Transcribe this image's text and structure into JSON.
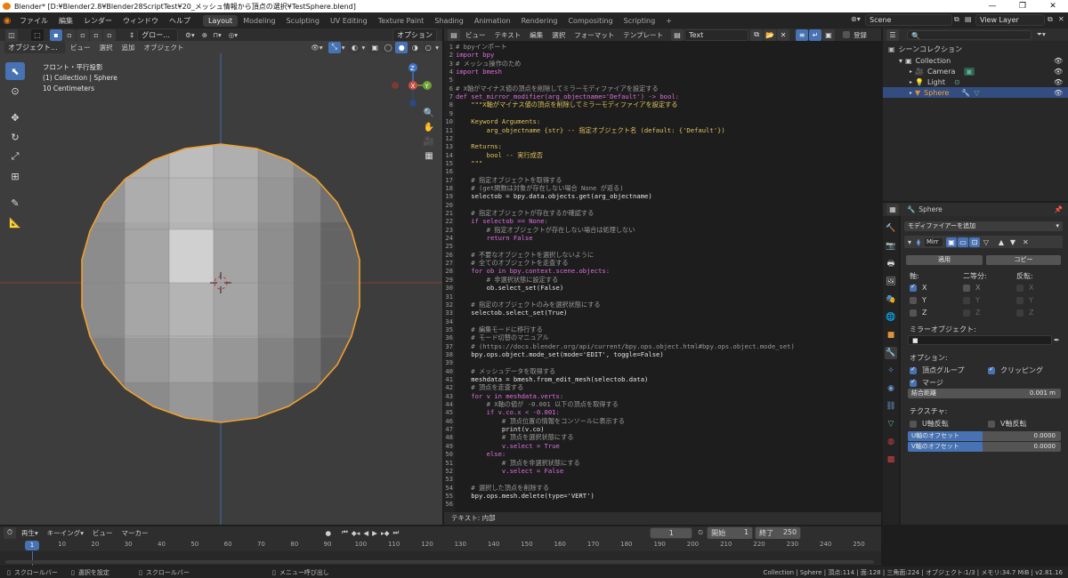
{
  "window": {
    "title": "Blender* [D:¥Blender2.8¥Blender28ScriptTest¥20_メッシュ情報から頂点の選択¥TestSphere.blend]",
    "controls": [
      "—",
      "❐",
      "✕"
    ]
  },
  "menubar": {
    "items": [
      "ファイル",
      "編集",
      "レンダー",
      "ウィンドウ",
      "ヘルプ"
    ],
    "workspaces": [
      "Layout",
      "Modeling",
      "Sculpting",
      "UV Editing",
      "Texture Paint",
      "Shading",
      "Animation",
      "Rendering",
      "Compositing",
      "Scripting"
    ],
    "active_workspace": "Layout",
    "add_tab": "+",
    "scene": "Scene",
    "view_layer": "View Layer"
  },
  "viewport": {
    "header": {
      "mode": "オブジェクト...",
      "menus": [
        "ビュー",
        "選択",
        "追加",
        "オブジェクト"
      ],
      "transform": "グロー...",
      "options": "オプション"
    },
    "info": [
      "フロント・平行投影",
      "(1) Collection | Sphere",
      "10 Centimeters"
    ],
    "gizmo": {
      "z": "Z",
      "y": "Y",
      "x": "X"
    }
  },
  "text_editor": {
    "menus": [
      "ビュー",
      "テキスト",
      "編集",
      "選択",
      "フォーマット",
      "テンプレート"
    ],
    "text_name": "Text",
    "register": "登録",
    "footer": "テキスト: 内部",
    "lines": [
      {
        "n": "1",
        "t": "# bpyインポート",
        "c": "cm"
      },
      {
        "n": "2",
        "t": "import bpy",
        "c": "kw"
      },
      {
        "n": "3",
        "t": "# メッシュ操作のため",
        "c": "cm"
      },
      {
        "n": "4",
        "t": "import bmesh",
        "c": "kw"
      },
      {
        "n": "5",
        "t": "",
        "c": "df"
      },
      {
        "n": "6",
        "t": "# X軸がマイナス値の頂点を削除してミラーモディファイアを設定する",
        "c": "cm"
      },
      {
        "n": "7",
        "t": "def set_mirror_modifier(arg_objectname='Default') -> bool:",
        "c": "kw"
      },
      {
        "n": "8",
        "t": "    \"\"\"X軸がマイナス値の頂点を削除してミラーモディファイアを設定する",
        "c": "st"
      },
      {
        "n": "9",
        "t": "",
        "c": "st"
      },
      {
        "n": "10",
        "t": "    Keyword Arguments:",
        "c": "st"
      },
      {
        "n": "11",
        "t": "        arg_objectname {str} -- 指定オブジェクト名 (default: {'Default'})",
        "c": "st"
      },
      {
        "n": "12",
        "t": "",
        "c": "st"
      },
      {
        "n": "13",
        "t": "    Returns:",
        "c": "st"
      },
      {
        "n": "14",
        "t": "        bool -- 実行成否",
        "c": "st"
      },
      {
        "n": "15",
        "t": "    \"\"\"",
        "c": "st"
      },
      {
        "n": "16",
        "t": "",
        "c": "df"
      },
      {
        "n": "17",
        "t": "    # 指定オブジェクトを取得する",
        "c": "cm"
      },
      {
        "n": "18",
        "t": "    # (get関数は対象が存在しない場合 None が返る)",
        "c": "cm"
      },
      {
        "n": "19",
        "t": "    selectob = bpy.data.objects.get(arg_objectname)",
        "c": "df"
      },
      {
        "n": "20",
        "t": "",
        "c": "df"
      },
      {
        "n": "21",
        "t": "    # 指定オブジェクトが存在するか確認する",
        "c": "cm"
      },
      {
        "n": "22",
        "t": "    if selectob == None:",
        "c": "kw"
      },
      {
        "n": "23",
        "t": "        # 指定オブジェクトが存在しない場合は処理しない",
        "c": "cm"
      },
      {
        "n": "24",
        "t": "        return False",
        "c": "kw"
      },
      {
        "n": "25",
        "t": "",
        "c": "df"
      },
      {
        "n": "26",
        "t": "    # 不要なオブジェクトを選択しないように",
        "c": "cm"
      },
      {
        "n": "27",
        "t": "    # 全てのオブジェクトを走査する",
        "c": "cm"
      },
      {
        "n": "28",
        "t": "    for ob in bpy.context.scene.objects:",
        "c": "kw"
      },
      {
        "n": "29",
        "t": "        # 非選択状態に設定する",
        "c": "cm"
      },
      {
        "n": "30",
        "t": "        ob.select_set(False)",
        "c": "df"
      },
      {
        "n": "31",
        "t": "",
        "c": "df"
      },
      {
        "n": "32",
        "t": "    # 指定のオブジェクトのみを選択状態にする",
        "c": "cm"
      },
      {
        "n": "33",
        "t": "    selectob.select_set(True)",
        "c": "df"
      },
      {
        "n": "34",
        "t": "",
        "c": "df"
      },
      {
        "n": "35",
        "t": "    # 編集モードに移行する",
        "c": "cm"
      },
      {
        "n": "36",
        "t": "    # モード切替のマニュアル",
        "c": "cm"
      },
      {
        "n": "37",
        "t": "    # (https://docs.blender.org/api/current/bpy.ops.object.html#bpy.ops.object.mode_set)",
        "c": "cm"
      },
      {
        "n": "38",
        "t": "    bpy.ops.object.mode_set(mode='EDIT', toggle=False)",
        "c": "df"
      },
      {
        "n": "39",
        "t": "",
        "c": "df"
      },
      {
        "n": "40",
        "t": "    # メッシュデータを取得する",
        "c": "cm"
      },
      {
        "n": "41",
        "t": "    meshdata = bmesh.from_edit_mesh(selectob.data)",
        "c": "df"
      },
      {
        "n": "42",
        "t": "    # 頂点を走査する",
        "c": "cm"
      },
      {
        "n": "43",
        "t": "    for v in meshdata.verts:",
        "c": "kw"
      },
      {
        "n": "44",
        "t": "        # X軸の値が -0.001 以下の頂点を取得する",
        "c": "cm"
      },
      {
        "n": "45",
        "t": "        if v.co.x < -0.001:",
        "c": "kw"
      },
      {
        "n": "46",
        "t": "            # 頂点位置の情報をコンソールに表示する",
        "c": "cm"
      },
      {
        "n": "47",
        "t": "            print(v.co)",
        "c": "df"
      },
      {
        "n": "48",
        "t": "            # 頂点を選択状態にする",
        "c": "cm"
      },
      {
        "n": "49",
        "t": "            v.select = True",
        "c": "kw"
      },
      {
        "n": "50",
        "t": "        else:",
        "c": "kw"
      },
      {
        "n": "51",
        "t": "            # 頂点を非選択状態にする",
        "c": "cm"
      },
      {
        "n": "52",
        "t": "            v.select = False",
        "c": "kw"
      },
      {
        "n": "53",
        "t": "",
        "c": "df"
      },
      {
        "n": "54",
        "t": "    # 選択した頂点を削除する",
        "c": "cm"
      },
      {
        "n": "55",
        "t": "    bpy.ops.mesh.delete(type='VERT')",
        "c": "df"
      },
      {
        "n": "56",
        "t": "",
        "c": "df"
      }
    ]
  },
  "outliner": {
    "root": "シーンコレクション",
    "items": [
      {
        "label": "Collection",
        "icon": "collection-icon"
      },
      {
        "label": "Camera",
        "icon": "camera-icon"
      },
      {
        "label": "Light",
        "icon": "light-icon"
      },
      {
        "label": "Sphere",
        "icon": "mesh-icon"
      }
    ]
  },
  "properties": {
    "object_name": "Sphere",
    "add_modifier": "モディファイアーを追加",
    "modifier_name": "Mirr",
    "apply": "適用",
    "copy": "コピー",
    "axis_label": "軸:",
    "bisect_label": "二等分:",
    "flip_label": "反転:",
    "axes": [
      "X",
      "Y",
      "Z"
    ],
    "axis_checked": [
      true,
      false,
      false
    ],
    "mirror_object_label": "ミラーオブジェクト:",
    "options_label": "オプション:",
    "vertex_groups": "頂点グループ",
    "clipping": "クリッピング",
    "merge": "マージ",
    "merge_distance_label": "結合距離",
    "merge_distance_value": "0.001 m",
    "textures_label": "テクスチャ:",
    "u_flip": "U軸反転",
    "v_flip": "V軸反転",
    "u_offset_label": "U軸のオフセット",
    "u_offset_value": "0.0000",
    "v_offset_label": "V軸のオフセット",
    "v_offset_value": "0.0000"
  },
  "timeline": {
    "menus": [
      "再生",
      "キーイング",
      "ビュー",
      "マーカー"
    ],
    "current_frame": "1",
    "start_label": "開始",
    "start_value": "1",
    "end_label": "終了",
    "end_value": "250",
    "ticks": [
      "1",
      "10",
      "20",
      "30",
      "40",
      "50",
      "60",
      "70",
      "80",
      "90",
      "100",
      "110",
      "120",
      "130",
      "140",
      "150",
      "160",
      "170",
      "180",
      "190",
      "200",
      "210",
      "220",
      "230",
      "240",
      "250"
    ]
  },
  "statusbar": {
    "left": [
      "スクロールバー",
      "選択を設定",
      "スクロールバー",
      "メニュー呼び出し"
    ],
    "right": "Collection | Sphere | 頂点:114 | 面:128 | 三角面:224 | オブジェクト:1/3 | メモリ:34.7 MiB | v2.81.16"
  },
  "colors": {
    "accent": "#4772b3",
    "selection_outline": "#f0a030",
    "axis_red": "#d0453c",
    "axis_blue": "#3f74c6"
  }
}
